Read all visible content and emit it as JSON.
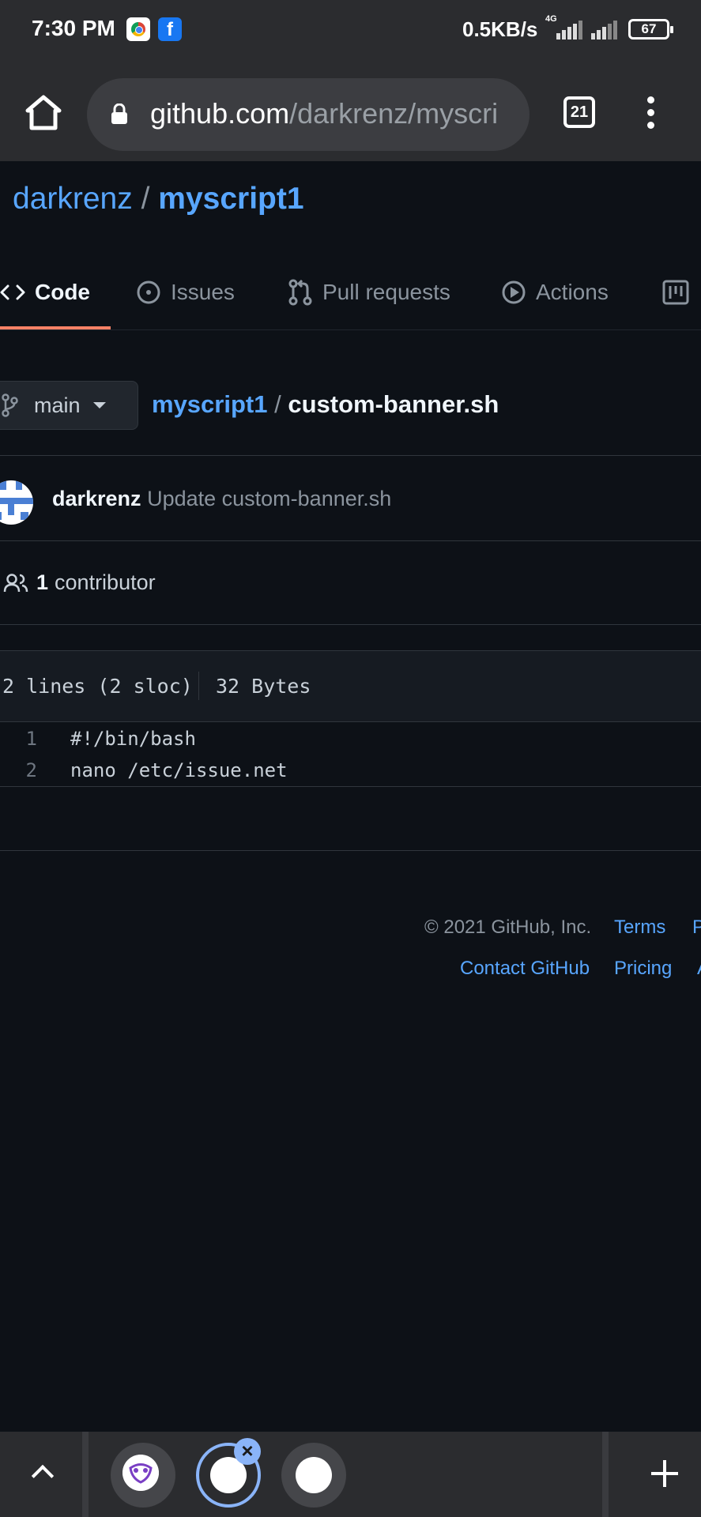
{
  "status_bar": {
    "time": "7:30 PM",
    "net_speed": "0.5KB/s",
    "network_type": "4G",
    "battery": "67",
    "icons": [
      "chrome-icon",
      "facebook-icon",
      "signal-icon",
      "signal-icon",
      "battery-icon"
    ]
  },
  "browser": {
    "url_host": "github.com",
    "url_path": "/darkrenz/myscri",
    "tab_count": "21",
    "icons": [
      "home-icon",
      "lock-icon",
      "tab-switcher-icon",
      "more-options-icon"
    ]
  },
  "repo": {
    "owner": "darkrenz",
    "separator": "/",
    "name": "myscript1"
  },
  "tabs": [
    {
      "label": "Code",
      "icon": "code-icon",
      "active": true
    },
    {
      "label": "Issues",
      "icon": "issue-icon",
      "active": false
    },
    {
      "label": "Pull requests",
      "icon": "pull-request-icon",
      "active": false
    },
    {
      "label": "Actions",
      "icon": "play-icon",
      "active": false
    },
    {
      "label": "",
      "icon": "project-icon",
      "active": false
    }
  ],
  "file_nav": {
    "branch": "main",
    "path_repo": "myscript1",
    "path_sep": "/",
    "path_file": "custom-banner.sh"
  },
  "commit": {
    "author": "darkrenz",
    "message": "Update custom-banner.sh"
  },
  "contributors": {
    "count": "1",
    "label": "contributor"
  },
  "file": {
    "lines_info": "2 lines (2 sloc)",
    "size": "32 Bytes",
    "lines": [
      {
        "number": "1",
        "content": "#!/bin/bash"
      },
      {
        "number": "2",
        "content": "nano /etc/issue.net"
      }
    ]
  },
  "footer": {
    "copyright": "© 2021 GitHub, Inc.",
    "links": [
      "Terms",
      "P",
      "Contact GitHub",
      "Pricing",
      "A"
    ]
  },
  "colors": {
    "background": "#0d1117",
    "link": "#58a6ff",
    "active_tab_underline": "#f78166",
    "chrome_bar": "#2b2c2f"
  }
}
